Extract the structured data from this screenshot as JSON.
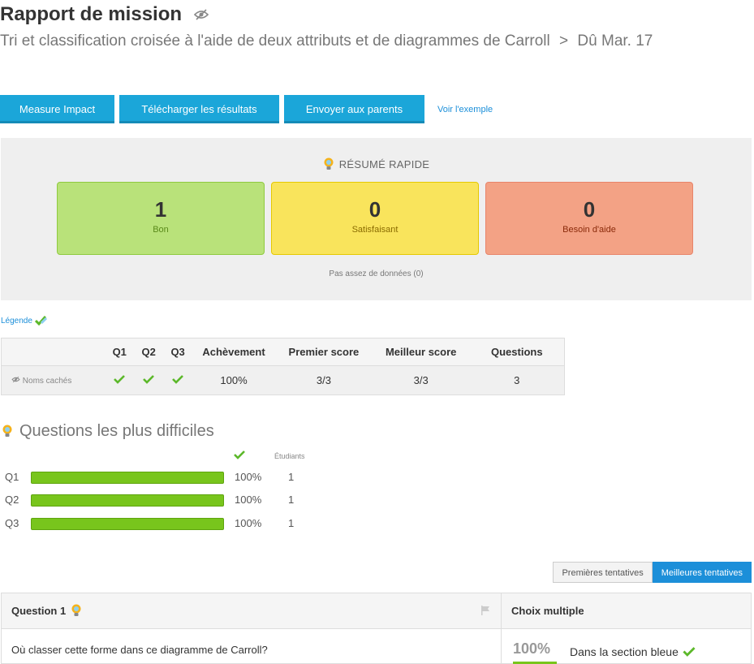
{
  "header": {
    "title": "Rapport de mission",
    "subtitle": "Tri et classification croisée à l'aide de deux attributs et de diagrammes de Carroll",
    "separator": ">",
    "due": "Dû Mar. 17"
  },
  "actions": {
    "measure": "Measure Impact",
    "download": "Télécharger les résultats",
    "send": "Envoyer aux parents",
    "example": "Voir l'exemple"
  },
  "summary": {
    "title": "RÉSUMÉ RAPIDE",
    "cards": [
      {
        "value": "1",
        "label": "Bon",
        "color": "#b9e27a"
      },
      {
        "value": "0",
        "label": "Satisfaisant",
        "color": "#f9e45c"
      },
      {
        "value": "0",
        "label": "Besoin d'aide",
        "color": "#f3a285"
      }
    ],
    "no_data": "Pas assez de données (0)"
  },
  "legend": "Légende",
  "results": {
    "headers": [
      "Q1",
      "Q2",
      "Q3",
      "Achèvement",
      "Premier score",
      "Meilleur score",
      "Questions"
    ],
    "row": {
      "name": "Noms cachés",
      "completion": "100%",
      "first_score": "3/3",
      "best_score": "3/3",
      "questions": "3"
    }
  },
  "hardest": {
    "title": "Questions les plus difficiles",
    "students_label": "Étudiants",
    "rows": [
      {
        "label": "Q1",
        "percent": "100%",
        "fill": 1.0,
        "count": "1"
      },
      {
        "label": "Q2",
        "percent": "100%",
        "fill": 1.0,
        "count": "1"
      },
      {
        "label": "Q3",
        "percent": "100%",
        "fill": 1.0,
        "count": "1"
      }
    ]
  },
  "attempts": {
    "first": "Premières tentatives",
    "best": "Meilleures tentatives"
  },
  "question": {
    "title": "Question 1",
    "type": "Choix multiple",
    "text": "Où classer cette forme dans ce diagramme de Carroll?",
    "percent": "100%",
    "answer": "Dans la section bleue"
  },
  "colors": {
    "accent": "#1ba6d9",
    "check": "#5cb82a",
    "bar": "#78c51c"
  }
}
